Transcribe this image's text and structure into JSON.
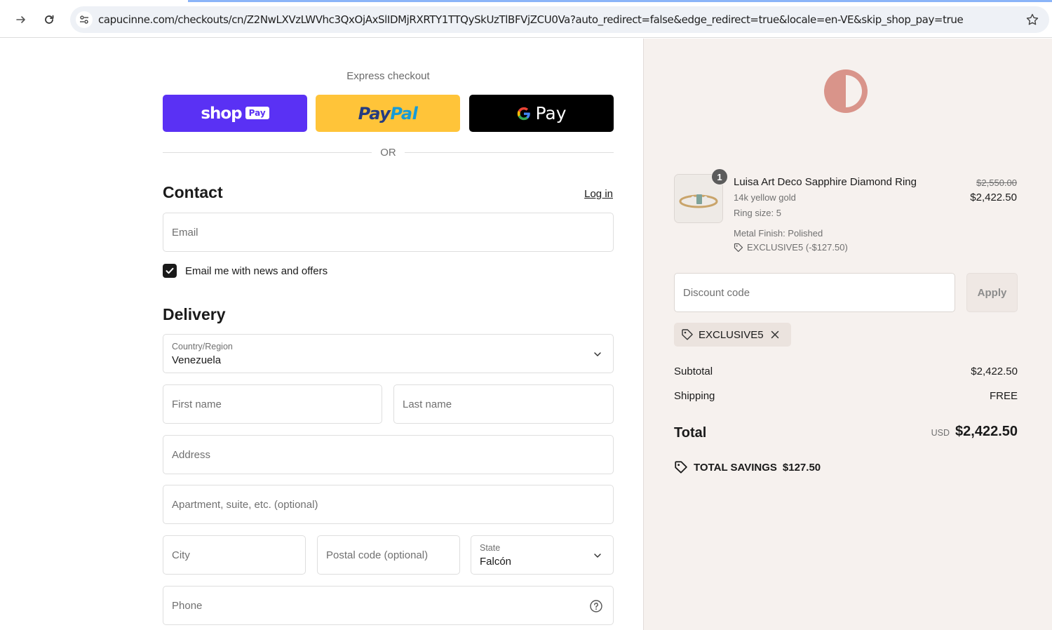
{
  "browser": {
    "url": "capucinne.com/checkouts/cn/Z2NwLXVzLWVhc3QxOjAxSlIDMjRXRTY1TTQySkUzTlBFVjZCU0Va?auto_redirect=false&edge_redirect=true&locale=en-VE&skip_shop_pay=true"
  },
  "express": {
    "label": "Express checkout",
    "shop_pay": "shop",
    "shop_pay_tag": "Pay",
    "paypal_a": "Pay",
    "paypal_b": "Pal",
    "gpay": "Pay",
    "or": "OR"
  },
  "contact": {
    "title": "Contact",
    "login": "Log in",
    "email_placeholder": "Email",
    "newsletter_label": "Email me with news and offers",
    "newsletter_checked": true
  },
  "delivery": {
    "title": "Delivery",
    "country_label": "Country/Region",
    "country_value": "Venezuela",
    "first_name": "First name",
    "last_name": "Last name",
    "address": "Address",
    "apartment": "Apartment, suite, etc. (optional)",
    "city": "City",
    "postal": "Postal code (optional)",
    "state_label": "State",
    "state_value": "Falcón",
    "phone": "Phone"
  },
  "order": {
    "item": {
      "quantity": "1",
      "name": "Luisa Art Deco Sapphire Diamond Ring",
      "variant": "14k yellow gold",
      "size": "Ring size: 5",
      "finish": "Metal Finish: Polished",
      "discount": "EXCLUSIVE5 (-$127.50)",
      "price_original": "$2,550.00",
      "price_final": "$2,422.50"
    },
    "discount_placeholder": "Discount code",
    "apply": "Apply",
    "applied_code": "EXCLUSIVE5",
    "subtotal_label": "Subtotal",
    "subtotal_value": "$2,422.50",
    "shipping_label": "Shipping",
    "shipping_value": "FREE",
    "total_label": "Total",
    "currency": "USD",
    "total_value": "$2,422.50",
    "savings_label": "TOTAL SAVINGS",
    "savings_value": "$127.50"
  },
  "colors": {
    "shop_pay": "#5a31f4",
    "paypal": "#ffc439",
    "gpay": "#000000",
    "summary_bg": "#f6f1ee",
    "brand_logo": "#d9948a"
  }
}
